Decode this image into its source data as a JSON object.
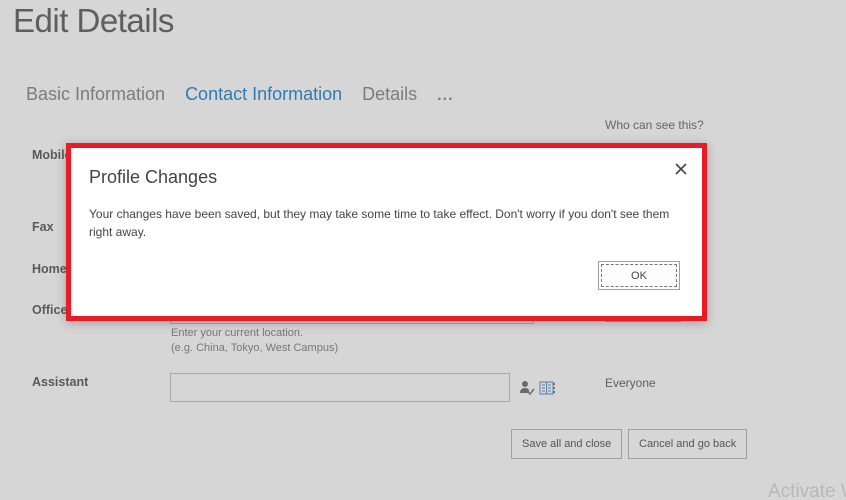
{
  "page": {
    "title": "Edit Details",
    "who_can_see": "Who can see this?"
  },
  "tabs": [
    {
      "label": "Basic Information",
      "active": false
    },
    {
      "label": "Contact Information",
      "active": true
    },
    {
      "label": "Details",
      "active": false
    },
    {
      "label": "...",
      "active": false
    }
  ],
  "fields": {
    "mobile": {
      "label": "Mobile phone",
      "value": ""
    },
    "fax": {
      "label": "Fax",
      "value": ""
    },
    "home": {
      "label": "Home phone",
      "value": ""
    },
    "office": {
      "label": "Office Location",
      "value": "",
      "hint_line1": "Enter your current location.",
      "hint_line2": "(e.g. China, Tokyo, West Campus)"
    },
    "assistant": {
      "label": "Assistant",
      "value": "",
      "visibility": "Everyone"
    }
  },
  "icons": {
    "check_names": "person-check-icon",
    "browse": "address-book-icon"
  },
  "buttons": {
    "save": "Save all and close",
    "cancel": "Cancel and go back"
  },
  "watermark": "Activate Windows",
  "dialog": {
    "title": "Profile Changes",
    "message": "Your changes have been saved, but they may take some time to take effect. Don't worry if you don't see them right away.",
    "ok_label": "OK",
    "close_icon": "close-icon",
    "border_color": "#e81c24"
  },
  "colors": {
    "accent": "#2f7bb4",
    "background": "#d6d6d6"
  }
}
